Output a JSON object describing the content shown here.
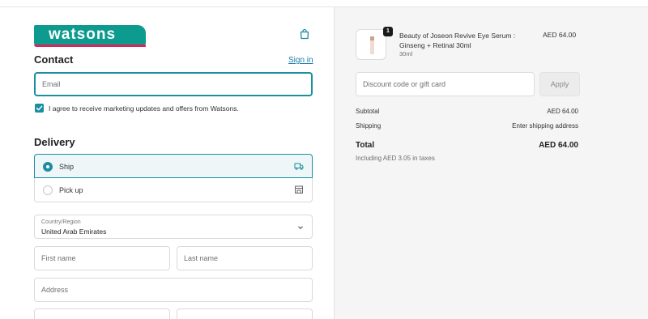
{
  "brand": {
    "logo_text": "watsons",
    "logo_color": "#0d9a8f",
    "logo_stripe_color": "#d6265b"
  },
  "contact": {
    "heading": "Contact",
    "sign_in": "Sign in",
    "email_placeholder": "Email",
    "marketing_label": "I agree to receive marketing updates and offers from Watsons."
  },
  "delivery": {
    "heading": "Delivery",
    "options": [
      {
        "label": "Ship",
        "selected": true,
        "icon": "truck-icon"
      },
      {
        "label": "Pick up",
        "selected": false,
        "icon": "store-icon"
      }
    ],
    "country_label": "Country/Region",
    "country_value": "United Arab Emirates",
    "first_name_placeholder": "First name",
    "last_name_placeholder": "Last name",
    "address_placeholder": "Address"
  },
  "summary": {
    "item": {
      "quantity": "1",
      "name": "Beauty of Joseon Revive Eye Serum : Ginseng + Retinal 30ml",
      "variant": "30ml",
      "price": "AED 64.00"
    },
    "discount_placeholder": "Discount code or gift card",
    "apply_label": "Apply",
    "subtotal_label": "Subtotal",
    "subtotal_value": "AED 64.00",
    "shipping_label": "Shipping",
    "shipping_value": "Enter shipping address",
    "total_label": "Total",
    "total_value": "AED 64.00",
    "tax_note": "Including AED 3.05 in taxes"
  },
  "colors": {
    "accent": "#1b8fa0",
    "summary_bg": "#f5f5f5"
  }
}
